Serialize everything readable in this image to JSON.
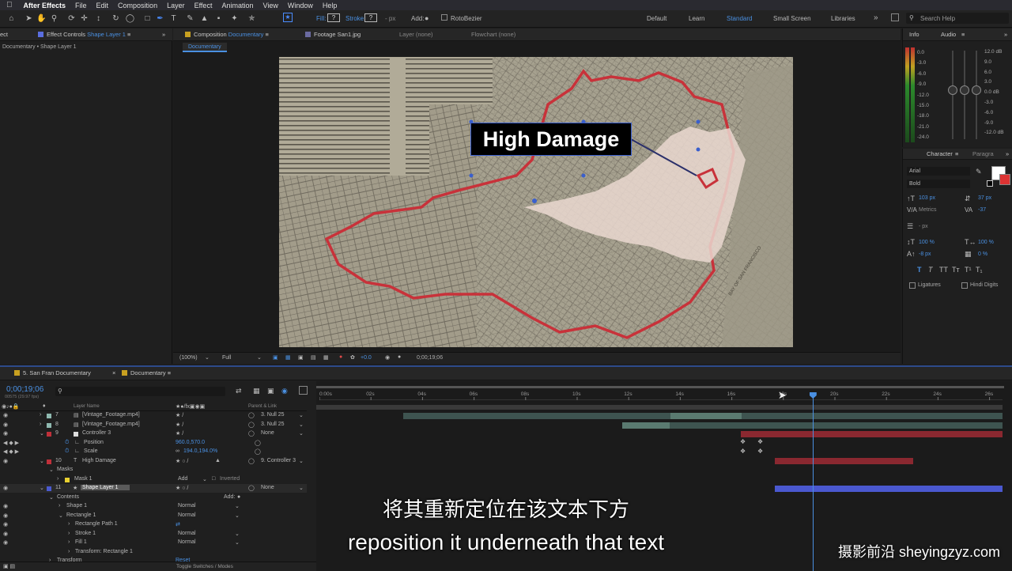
{
  "menubar": {
    "apple_icon": "apple-logo",
    "app": "After Effects",
    "items": [
      "File",
      "Edit",
      "Composition",
      "Layer",
      "Effect",
      "Animation",
      "View",
      "Window",
      "Help"
    ]
  },
  "toolbar": {
    "fill_label": "Fill:",
    "fill_value": "?",
    "stroke_label": "Stroke:",
    "stroke_value": "?",
    "stroke_px": "- px",
    "add_label": "Add:",
    "roto_label": "RotoBezier",
    "workspaces": [
      "Default",
      "Learn",
      "Standard",
      "Small Screen",
      "Libraries"
    ],
    "active_workspace": "Standard",
    "search_placeholder": "Search Help"
  },
  "left_panel": {
    "tab_partial": "ect",
    "tab_effect_controls": "Effect Controls",
    "tab_effect_layer": "Shape Layer 1",
    "subheader": "Documentary • Shape Layer 1"
  },
  "comp_panel": {
    "tab_composition": "Composition",
    "tab_comp_name": "Documentary",
    "tab_footage": "Footage San1.jpg",
    "tab_layer": "Layer (none)",
    "tab_flowchart": "Flowchart (none)",
    "subtab": "Documentary",
    "overlay_text": "High Damage",
    "zoom": "(100%)",
    "resolution": "Full",
    "exposure": "+0.0",
    "timecode": "0;00;19;06",
    "map_stamp": "BAY OF SAN FRANCISCO"
  },
  "info_panel": {
    "tab_info": "Info",
    "tab_audio": "Audio",
    "left_scale": [
      "0.0",
      "-3.0",
      "-6.0",
      "-9.0",
      "-12.0",
      "-15.0",
      "-18.0",
      "-21.0",
      "-24.0"
    ],
    "right_db": [
      "12.0 dB",
      "9.0",
      "6.0",
      "3.0",
      "0.0 dB",
      "-3.0",
      "-6.0",
      "-9.0",
      "-12.0 dB"
    ]
  },
  "character_panel": {
    "tab_character": "Character",
    "tab_paragraph": "Paragra",
    "font_family": "Arial",
    "font_style": "Bold",
    "font_size": "103 px",
    "leading": "37 px",
    "kerning": "Metrics",
    "tracking": "-37",
    "stroke_width": "- px",
    "vert_scale": "100 %",
    "horiz_scale": "100 %",
    "baseline": "-8 px",
    "tsume": "0 %",
    "style_buttons": [
      "T",
      "T",
      "TT",
      "Tт",
      "T¹",
      "T₁"
    ],
    "ligatures": "Ligatures",
    "hindi_digits": "Hindi Digits"
  },
  "timeline": {
    "tab_project": "5. San Fran Documentary",
    "tab_active": "Documentary",
    "timecode": "0;00;19;06",
    "fps": "00575 (29.97 fps)",
    "search_placeholder": "",
    "col_layer_name": "Layer Name",
    "col_parent": "Parent & Link",
    "ruler": [
      "0:00s",
      "02s",
      "04s",
      "06s",
      "08s",
      "10s",
      "12s",
      "14s",
      "16s",
      "18s",
      "20s",
      "22s",
      "24s",
      "26s"
    ],
    "current_time_fraction": 0.722,
    "rows": [
      {
        "num": "7",
        "name": "[Vintage_Footage.mp4]",
        "parent": "3. Null 25"
      },
      {
        "num": "8",
        "name": "[Vintage_Footage.mp4]",
        "parent": "3. Null 25"
      },
      {
        "num": "9",
        "name": "Controller 3",
        "parent": "None"
      },
      {
        "num": "",
        "name": "Position",
        "value": "960.0,570.0"
      },
      {
        "num": "",
        "name": "Scale",
        "value": "194.0,194.0%"
      },
      {
        "num": "10",
        "name": "High Damage",
        "parent": "9. Controller 3"
      },
      {
        "num": "",
        "name": "Masks"
      },
      {
        "num": "",
        "name": "Mask 1",
        "mode": "Add",
        "inverted": "Inverted"
      },
      {
        "num": "11",
        "name": "Shape Layer 1",
        "parent": "None"
      },
      {
        "num": "",
        "name": "Contents",
        "add": "Add:"
      },
      {
        "num": "",
        "name": "Shape 1",
        "mode": "Normal"
      },
      {
        "num": "",
        "name": "Rectangle 1",
        "mode": "Normal"
      },
      {
        "num": "",
        "name": "Rectangle Path 1"
      },
      {
        "num": "",
        "name": "Stroke 1",
        "mode": "Normal"
      },
      {
        "num": "",
        "name": "Fill 1",
        "mode": "Normal"
      },
      {
        "num": "",
        "name": "Transform: Rectangle 1"
      },
      {
        "num": "",
        "name": "Transform",
        "reset": "Reset"
      }
    ],
    "toggle_label": "Toggle Switches / Modes"
  },
  "subtitles": {
    "chinese": "将其重新定位在该文本下方",
    "english": "reposition it underneath that text"
  },
  "watermark": "摄影前沿 sheyingzyz.com"
}
